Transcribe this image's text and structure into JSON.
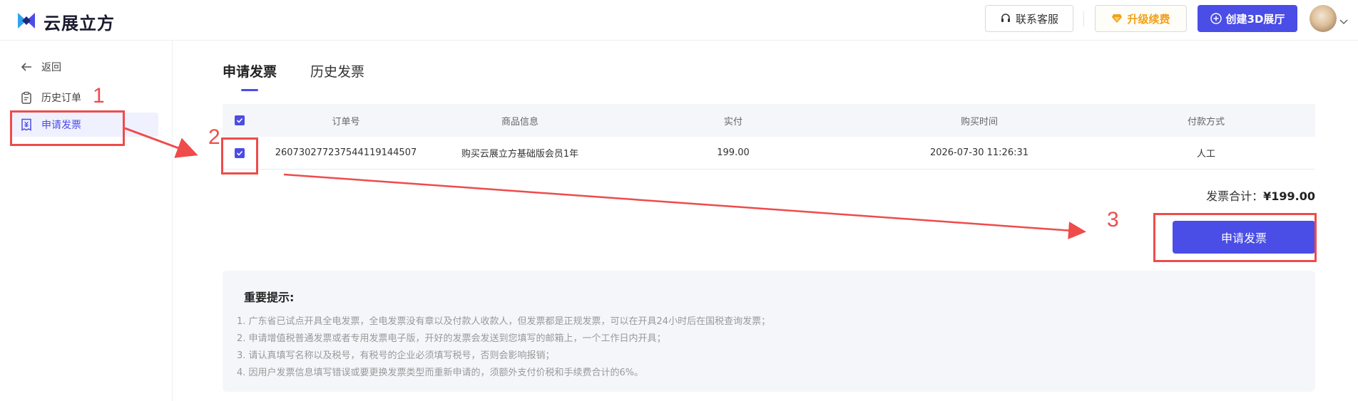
{
  "header": {
    "logo_text": "云展立方",
    "service_label": "联系客服",
    "upgrade_label": "升级续费",
    "create_label": "创建3D展厅",
    "accent_color": "#4a4de6",
    "upgrade_color": "#f2a117"
  },
  "sidebar": {
    "items": [
      {
        "label": "返回",
        "icon": "arrow-left-icon"
      },
      {
        "label": "历史订单",
        "icon": "clipboard-icon"
      },
      {
        "label": "申请发票",
        "icon": "receipt-yen-icon",
        "active": true
      }
    ]
  },
  "tabs": [
    {
      "label": "申请发票",
      "active": true
    },
    {
      "label": "历史发票",
      "active": false
    }
  ],
  "table": {
    "headers": [
      "订单号",
      "商品信息",
      "实付",
      "购买时间",
      "付款方式"
    ],
    "rows": [
      {
        "checked": true,
        "order_no": "26073027723754411914450​7",
        "goods": "购买云展立方基础版会员1年",
        "paid": "199.00",
        "time": "2026-07-30 11:26:31",
        "method": "人工"
      }
    ]
  },
  "summary": {
    "total_label": "发票合计：",
    "total_value": "¥199.00",
    "apply_button": "申请发票"
  },
  "notice": {
    "title": "重要提示:",
    "lines": [
      "1. 广东省已试点开具全电发票，全电发票没有章以及付款人收款人，但发票都是正规发票，可以在开具24小时后在国税查询发票；",
      "2. 申请增值税普通发票或者专用发票电子版，开好的发票会发送到您填写的邮箱上，一个工作日内开具；",
      "3. 请认真填写名称以及税号，有税号的企业必须填写税号，否则会影响报销；",
      "4. 因用户发票信息填写错误或要更换发票类型而重新申请的，须额外支付价税和手续费合计的6%。"
    ]
  },
  "annotations": {
    "num1": "1",
    "num2": "2",
    "num3": "3",
    "color": "#ef4b4b"
  }
}
